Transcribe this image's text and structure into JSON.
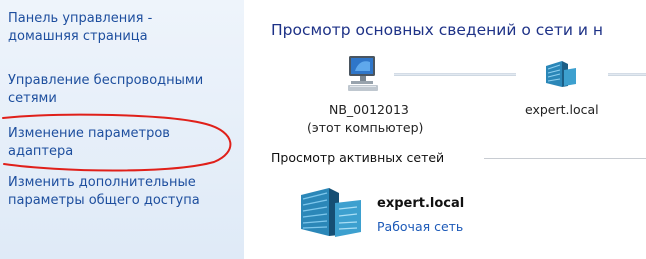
{
  "sidebar": {
    "links": [
      "Панель управления -\nдомашняя страница",
      "Управление беспроводными\nсетями",
      "Изменение параметров\nадаптера",
      "Изменить дополнительные\nпараметры общего доступа"
    ]
  },
  "main": {
    "title": "Просмотр основных сведений о сети и н",
    "map": {
      "computer_name": "NB_0012013",
      "computer_note": "(этот компьютер)",
      "domain_node": "expert.local"
    },
    "active_networks_header": "Просмотр активных сетей",
    "active_network": {
      "name": "expert.local",
      "type": "Рабочая сеть"
    }
  },
  "annotation": {
    "highlight_color": "#e0201a"
  },
  "colors": {
    "link": "#1d4e9e",
    "title": "#1e3287",
    "sidebar_bg": "#e6eff9"
  },
  "icons": {
    "computer": "computer-icon",
    "domain_server": "server-icon",
    "active_network": "server-building-icon"
  }
}
